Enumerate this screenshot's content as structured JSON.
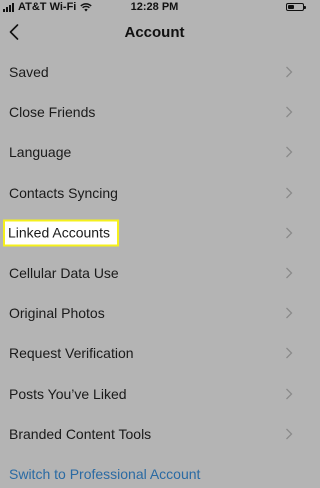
{
  "status_bar": {
    "carrier": "AT&T Wi-Fi",
    "time": "12:28 PM",
    "icons": [
      "cellular-signal-icon",
      "wifi-icon",
      "battery-icon"
    ]
  },
  "header": {
    "title": "Account",
    "back_icon": "chevron-left-icon"
  },
  "menu": {
    "items": [
      {
        "label": "Saved"
      },
      {
        "label": "Close Friends"
      },
      {
        "label": "Language"
      },
      {
        "label": "Contacts Syncing"
      },
      {
        "label": "Linked Accounts",
        "highlighted": true
      },
      {
        "label": "Cellular Data Use"
      },
      {
        "label": "Original Photos"
      },
      {
        "label": "Request Verification"
      },
      {
        "label": "Posts You’ve Liked"
      },
      {
        "label": "Branded Content Tools"
      }
    ],
    "chevron_icon": "chevron-right-icon"
  },
  "switch_link": {
    "label": "Switch to Professional Account"
  },
  "colors": {
    "background": "#b4b4b4",
    "link": "#2a6aa3",
    "highlight_border": "#f5f01c"
  }
}
